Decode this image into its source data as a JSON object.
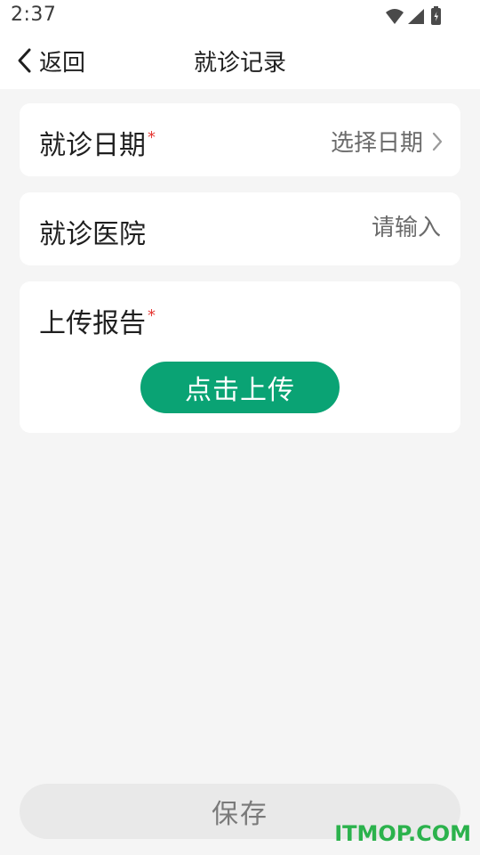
{
  "status_bar": {
    "time": "2:37",
    "icons": [
      "wifi-icon",
      "cellular-signal-icon",
      "battery-icon"
    ]
  },
  "nav": {
    "back_label": "返回",
    "title": "就诊记录"
  },
  "form": {
    "visit_date": {
      "label": "就诊日期",
      "required_mark": "*",
      "placeholder": "选择日期"
    },
    "hospital": {
      "label": "就诊医院",
      "placeholder": "请输入",
      "value": ""
    },
    "report": {
      "label": "上传报告",
      "required_mark": "*",
      "upload_label": "点击上传"
    }
  },
  "actions": {
    "save_label": "保存"
  },
  "watermark": "ITMOP.COM",
  "colors": {
    "accent": "#0aa374",
    "required": "#e53935",
    "background": "#f5f5f5",
    "card": "#ffffff",
    "disabled_button": "#e9e9e9",
    "watermark": "#2bb24c"
  }
}
